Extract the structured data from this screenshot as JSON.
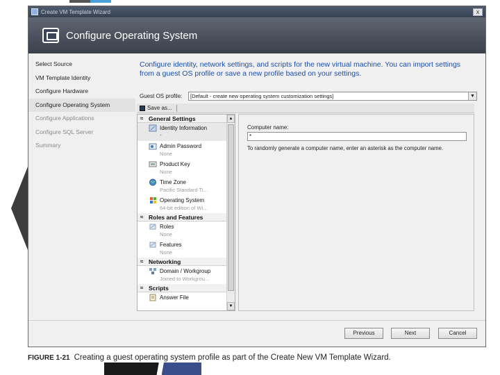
{
  "window": {
    "title": "Create VM Template Wizard",
    "close_glyph": "x",
    "header_title": "Configure Operating System"
  },
  "nav": {
    "items": [
      {
        "label": "Select Source",
        "state": "normal"
      },
      {
        "label": "VM Template Identity",
        "state": "normal"
      },
      {
        "label": "Configure Hardware",
        "state": "normal"
      },
      {
        "label": "Configure Operating System",
        "state": "current"
      },
      {
        "label": "Configure Applications",
        "state": "disabled"
      },
      {
        "label": "Configure SQL Server",
        "state": "disabled"
      },
      {
        "label": "Summary",
        "state": "disabled"
      }
    ]
  },
  "content": {
    "intro": "Configure identity, network settings, and scripts for the new virtual machine. You can import settings from a guest OS profile or save a new profile based on your settings.",
    "profile_label": "Guest OS profile:",
    "profile_value": "[Default - create new operating system customization settings]",
    "save_as": "Save as...",
    "groups": [
      {
        "title": "General Settings",
        "items": [
          {
            "label": "Identity Information",
            "sub": "*",
            "icon": "identity-icon"
          },
          {
            "label": "Admin Password",
            "sub": "None",
            "icon": "password-icon"
          },
          {
            "label": "Product Key",
            "sub": "None",
            "icon": "key-icon"
          },
          {
            "label": "Time Zone",
            "sub": "Pacific Standard Ti...",
            "icon": "globe-icon"
          },
          {
            "label": "Operating System",
            "sub": "64-bit edition of Wi...",
            "icon": "windows-icon"
          }
        ]
      },
      {
        "title": "Roles and Features",
        "items": [
          {
            "label": "Roles",
            "sub": "None",
            "icon": "roles-icon"
          },
          {
            "label": "Features",
            "sub": "None",
            "icon": "features-icon"
          }
        ]
      },
      {
        "title": "Networking",
        "items": [
          {
            "label": "Domain / Workgroup",
            "sub": "Joined to Workgrou...",
            "icon": "network-icon"
          }
        ]
      },
      {
        "title": "Scripts",
        "items": [
          {
            "label": "Answer File",
            "sub": "",
            "icon": "answer-file-icon"
          }
        ]
      }
    ],
    "detail": {
      "label": "Computer name:",
      "value": "*",
      "help": "To randomly generate a computer name, enter an asterisk as the computer name."
    }
  },
  "footer": {
    "previous": "Previous",
    "next": "Next",
    "cancel": "Cancel"
  },
  "caption": {
    "figure": "FIGURE 1-21",
    "text": "Creating a guest operating system profile as part of the Create New VM Template Wizard."
  },
  "colors": {
    "intro_text": "#1b4ea8",
    "header_bg": "#4b515c"
  }
}
